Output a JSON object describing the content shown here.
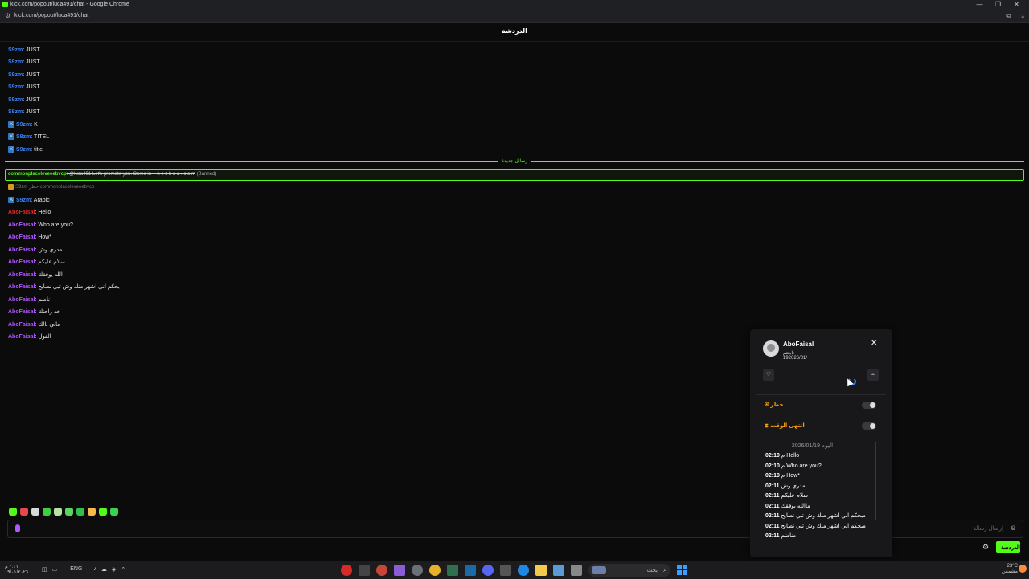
{
  "window": {
    "title": "kick.com/popout/luca491/chat - Google Chrome",
    "controls": [
      "—",
      "❐",
      "✕"
    ]
  },
  "address_bar": {
    "url": "kick.com/popout/luca491/chat"
  },
  "chat": {
    "header": "الدردشة",
    "messages": [
      {
        "user": "S9zm",
        "text": ": JUST",
        "color": "blue",
        "badge": false
      },
      {
        "user": "S9zm",
        "text": ": JUST",
        "color": "blue",
        "badge": false
      },
      {
        "user": "S9zm",
        "text": ": JUST",
        "color": "blue",
        "badge": false
      },
      {
        "user": "S9zm",
        "text": ": JUST",
        "color": "blue",
        "badge": false
      },
      {
        "user": "S9zm",
        "text": ": JUST",
        "color": "blue",
        "badge": false
      },
      {
        "user": "S9zm",
        "text": ": JUST",
        "color": "blue",
        "badge": false
      },
      {
        "user": "S9zm",
        "text": ": K",
        "color": "blue",
        "badge": true
      },
      {
        "user": "S9zm",
        "text": ": TITEL",
        "color": "blue",
        "badge": true
      },
      {
        "user": "S9zm",
        "text": ": title",
        "color": "blue",
        "badge": true
      }
    ],
    "new_messages_label": "رسائل جديدة",
    "banned_message": {
      "user": "commonplaceleveeebvcp",
      "text": ": @luca491 Let's promote you. Come in -- n e z h n a . c o m",
      "tag": "(Banned)"
    },
    "mod_action": "S9zm حظر commonplaceleveeebvcp",
    "messages_after": [
      {
        "user": "S9zm",
        "text": ": Arabic",
        "color": "blue",
        "badge": true
      },
      {
        "user": "AboFaisal",
        "text": ": Hello",
        "color": "red",
        "badge": false
      },
      {
        "user": "AboFaisal",
        "text": ": Who are you?",
        "color": "purple",
        "badge": false
      },
      {
        "user": "AboFaisal",
        "text": ": How*",
        "color": "purple",
        "badge": false
      },
      {
        "user": "AboFaisal",
        "text": ": مدري وش",
        "color": "purple",
        "badge": false
      },
      {
        "user": "AboFaisal",
        "text": ": سلام عليكم",
        "color": "purple",
        "badge": false
      },
      {
        "user": "AboFaisal",
        "text": ": الله يوفقك",
        "color": "purple",
        "badge": false
      },
      {
        "user": "AboFaisal",
        "text": ": بحكم اني اشهر منك وش تبي نصايح",
        "color": "purple",
        "badge": false
      },
      {
        "user": "AboFaisal",
        "text": ": ناضم",
        "color": "purple",
        "badge": false
      },
      {
        "user": "AboFaisal",
        "text": ": خذ راحتك",
        "color": "purple",
        "badge": false
      },
      {
        "user": "AboFaisal",
        "text": ": مابي بالك",
        "color": "purple",
        "badge": false
      },
      {
        "user": "AboFaisal",
        "text": ": القول",
        "color": "purple",
        "badge": false
      }
    ],
    "input_placeholder": "إرسال رسالة",
    "send_label": "الدردشة"
  },
  "user_card": {
    "username": "AboFaisal",
    "label": "تابعتم",
    "date": "192026/01/",
    "ban_label": "حظر",
    "timeout_label": "انتهى الوقت",
    "history_date": "اليوم 2026/01/19",
    "history": [
      {
        "time": "02:10",
        "text": "م Hello"
      },
      {
        "time": "02:10",
        "text": "م Who are you?"
      },
      {
        "time": "02:10",
        "text": "م How*"
      },
      {
        "time": "02:11",
        "text": "مدري وش"
      },
      {
        "time": "02:11",
        "text": "سلام عليكم"
      },
      {
        "time": "02:11",
        "text": "ماالله يوفقك"
      },
      {
        "time": "02:11",
        "text": "مبحكم اني اشهر منك وش تبي نصايح"
      },
      {
        "time": "02:11",
        "text": "مبحكم اني اشهر منك وش تبي نصايح"
      },
      {
        "time": "02:11",
        "text": "مناضم"
      }
    ]
  },
  "taskbar": {
    "search_text": "بحث",
    "lang": "ENG",
    "clock_time": "٢:١١ م",
    "clock_date": "١٩/٠١/٢٠٢٦",
    "weather_temp": "23°C",
    "weather_desc": "مشمس"
  }
}
